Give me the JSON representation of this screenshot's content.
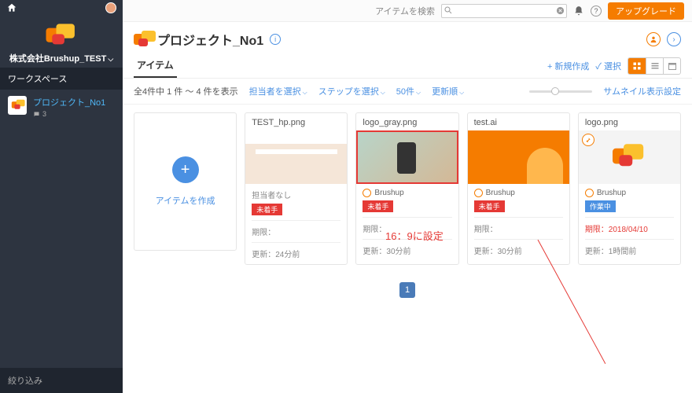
{
  "sidebar": {
    "workspace_name": "株式会社Brushup_TEST",
    "section_label": "ワークスペース",
    "project": {
      "name": "プロジェクト_No1",
      "comment_count": "3"
    },
    "filter_label": "絞り込み"
  },
  "topbar": {
    "search_label": "アイテムを検索",
    "search_placeholder": "",
    "upgrade_label": "アップグレード"
  },
  "header": {
    "title": "プロジェクト_No1"
  },
  "tabs": {
    "items_label": "アイテム",
    "new_label": "+ 新規作成",
    "select_label": "✓ 選択"
  },
  "filters": {
    "count_text": "全4件中 1 件 ～ 4 件を表示",
    "assignee": "担当者を選択",
    "step": "ステップを選択",
    "per_page": "50件",
    "sort": "更新順",
    "thumb_settings": "サムネイル表示設定"
  },
  "create_card": {
    "label": "アイテムを作成"
  },
  "items": [
    {
      "title": "TEST_hp.png",
      "assignee": "担当者なし",
      "badge": "未着手",
      "due_label": "期限：",
      "due": "",
      "updated": "更新：24分前",
      "highlight": false,
      "pin": false,
      "noassign": true,
      "badge_color": "red"
    },
    {
      "title": "logo_gray.png",
      "assignee": "Brushup",
      "badge": "未着手",
      "due_label": "期限：",
      "due": "",
      "updated": "更新：30分前",
      "highlight": true,
      "pin": false,
      "noassign": false,
      "badge_color": "red"
    },
    {
      "title": "test.ai",
      "assignee": "Brushup",
      "badge": "未着手",
      "due_label": "期限：",
      "due": "",
      "updated": "更新：30分前",
      "highlight": false,
      "pin": false,
      "noassign": false,
      "badge_color": "red"
    },
    {
      "title": "logo.png",
      "assignee": "Brushup",
      "badge": "作業中",
      "due_label": "期限：",
      "due": "2018/04/10",
      "updated": "更新：1時間前",
      "highlight": false,
      "pin": true,
      "noassign": false,
      "badge_color": "blue",
      "due_red": true
    }
  ],
  "pager": {
    "current": "1"
  },
  "annotation": {
    "text": "16：9に設定"
  }
}
